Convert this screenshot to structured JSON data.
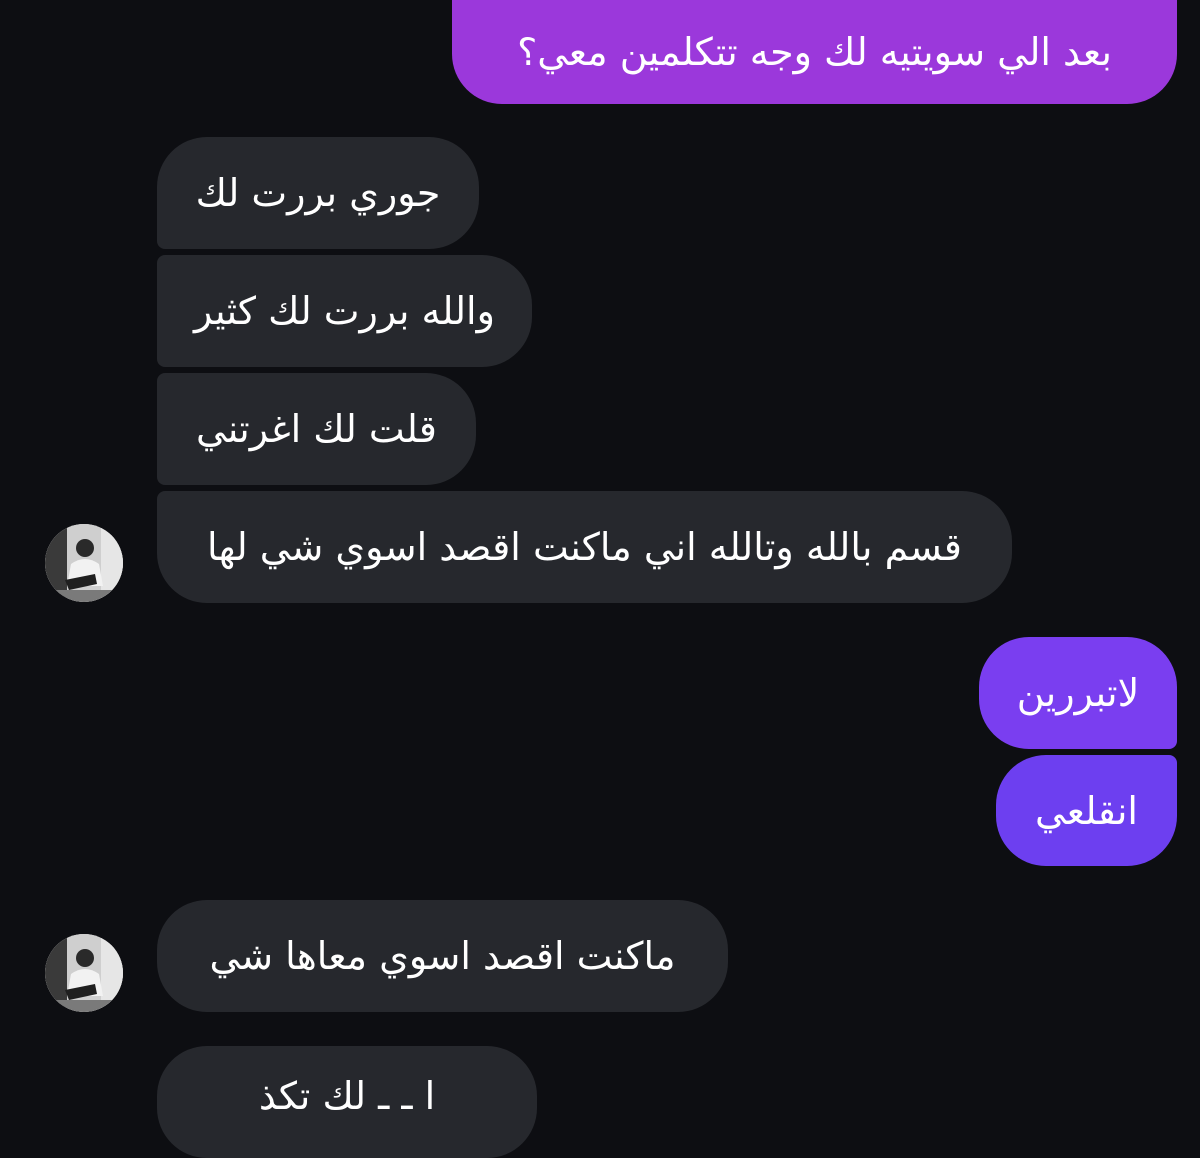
{
  "messages": [
    {
      "id": "s1",
      "direction": "sent",
      "text": "بعد الي سويتيه لك وجه تتكلمين معي؟"
    },
    {
      "id": "r1",
      "direction": "received",
      "text": "جوري بررت لك"
    },
    {
      "id": "r2",
      "direction": "received",
      "text": "والله بررت لك كثير"
    },
    {
      "id": "r3",
      "direction": "received",
      "text": "قلت لك اغرتني"
    },
    {
      "id": "r4",
      "direction": "received",
      "text": "قسم بالله وتالله اني ماكنت اقصد اسوي شي لها"
    },
    {
      "id": "s2",
      "direction": "sent",
      "text": "لاتبررين"
    },
    {
      "id": "s3",
      "direction": "sent",
      "text": "انقلعي"
    },
    {
      "id": "r5",
      "direction": "received",
      "text": "ماكنت اقصد اسوي معاها شي"
    },
    {
      "id": "r6",
      "direction": "received",
      "text": "ا    ـ  ـ  لك تكذ"
    }
  ],
  "colors": {
    "background": "#0d0e12",
    "received_bubble": "#26282d",
    "sent_bubble_top": "#9b38db",
    "sent_bubble_mid": "#7a3ef0",
    "sent_bubble_bottom": "#6d3ff0",
    "text": "#ffffff"
  },
  "avatar": {
    "icon": "contact-avatar-photo"
  }
}
